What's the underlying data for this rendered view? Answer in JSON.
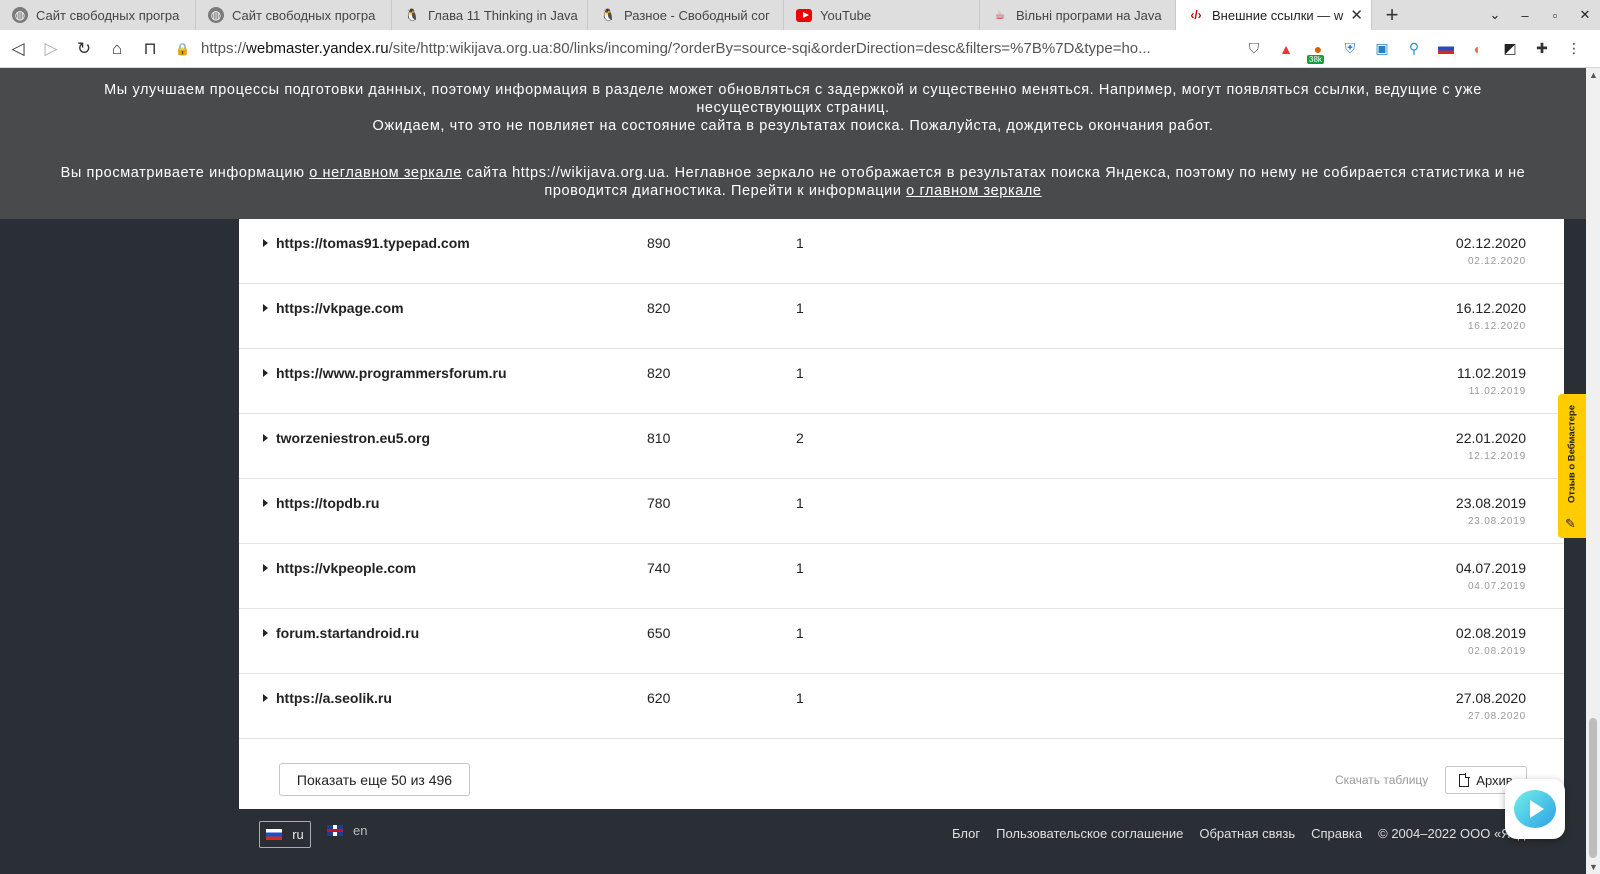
{
  "tabs": [
    {
      "title": "Сайт свободных програ",
      "icon": "globe-icon"
    },
    {
      "title": "Сайт свободных програ",
      "icon": "globe-icon"
    },
    {
      "title": "Глава 11 Thinking in Java",
      "icon": "penguin-icon"
    },
    {
      "title": "Разное - Свободный сог",
      "icon": "penguin-icon"
    },
    {
      "title": "YouTube",
      "icon": "youtube-icon"
    },
    {
      "title": "Вільні програми на Java",
      "icon": "java-icon"
    },
    {
      "title": "Внешние ссылки — w",
      "icon": "webmaster-icon",
      "active": true
    }
  ],
  "toolbar": {
    "url_scheme": "https://",
    "url_host": "webmaster.yandex.ru",
    "url_path": "/site/http:wikijava.org.ua:80/links/incoming/?orderBy=source-sqi&orderDirection=desc&filters=%7B%7D&type=ho...",
    "badge_count": "38k"
  },
  "notice": {
    "line1": "Мы улучшаем процессы подготовки данных, поэтому информация в разделе может обновляться с задержкой и существенно меняться. Например, могут появляться ссылки, ведущие с уже несуществующих страниц.",
    "line2": "Ожидаем, что это не повлияет на состояние сайта в результатах поиска. Пожалуйста, дождитесь окончания работ.",
    "mirror_pre": "Вы просматриваете информацию ",
    "mirror_link1": "о неглавном зеркале",
    "mirror_mid": " сайта https://wikijava.org.ua. Неглавное зеркало не отображается в результатах поиска Яндекса, поэтому по нему не собирается статистика и не проводится диагностика. Перейти к информации ",
    "mirror_link2": "о главном зеркале"
  },
  "rows": [
    {
      "source": "https://tomas91.typepad.com",
      "sqi": "890",
      "links": "1",
      "date": "02.12.2020",
      "date_small": "02.12.2020"
    },
    {
      "source": "https://vkpage.com",
      "sqi": "820",
      "links": "1",
      "date": "16.12.2020",
      "date_small": "16.12.2020"
    },
    {
      "source": "https://www.programmersforum.ru",
      "sqi": "820",
      "links": "1",
      "date": "11.02.2019",
      "date_small": "11.02.2019"
    },
    {
      "source": "tworzeniestron.eu5.org",
      "sqi": "810",
      "links": "2",
      "date": "22.01.2020",
      "date_small": "12.12.2019"
    },
    {
      "source": "https://topdb.ru",
      "sqi": "780",
      "links": "1",
      "date": "23.08.2019",
      "date_small": "23.08.2019"
    },
    {
      "source": "https://vkpeople.com",
      "sqi": "740",
      "links": "1",
      "date": "04.07.2019",
      "date_small": "04.07.2019"
    },
    {
      "source": "forum.startandroid.ru",
      "sqi": "650",
      "links": "1",
      "date": "02.08.2019",
      "date_small": "02.08.2019"
    },
    {
      "source": "https://a.seolik.ru",
      "sqi": "620",
      "links": "1",
      "date": "27.08.2020",
      "date_small": "27.08.2020"
    }
  ],
  "table_footer": {
    "more_label": "Показать еще 50 из 496",
    "download_label": "Скачать таблицу",
    "archive_label": "Архив"
  },
  "feedback_tab": "Отзыв о Вебмастере",
  "footer": {
    "lang_ru": "ru",
    "lang_en": "en",
    "links": [
      "Блог",
      "Пользовательское соглашение",
      "Обратная связь",
      "Справка",
      "© 2004–2022 ООО «Яндекс»"
    ]
  },
  "colors": {
    "notice_bg": "#494a4b",
    "page_bg": "#2a2f36",
    "feedback_yellow": "#ffcc00"
  }
}
